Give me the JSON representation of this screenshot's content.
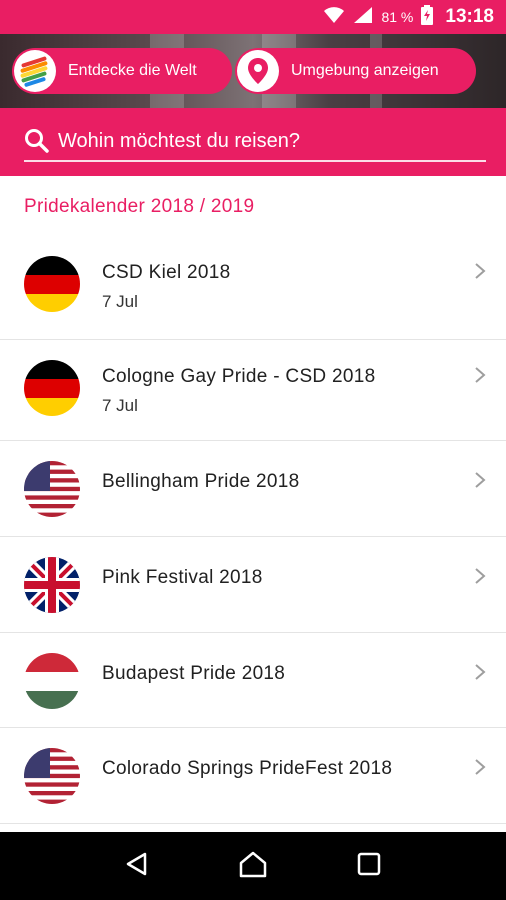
{
  "status_bar": {
    "battery_percent": "81 %",
    "time": "13:18",
    "icons": [
      "wifi-icon",
      "signal-icon",
      "battery-icon"
    ]
  },
  "header": {
    "discover_button_label": "Entdecke die Welt",
    "nearby_button_label": "Umgebung anzeigen"
  },
  "search": {
    "placeholder": "Wohin möchtest du reisen?"
  },
  "section": {
    "title": "Pridekalender 2018 / 2019"
  },
  "events": [
    {
      "name": "CSD Kiel 2018",
      "date": "7 Jul",
      "flag": "germany"
    },
    {
      "name": "Cologne Gay Pride - CSD 2018",
      "date": "7 Jul",
      "flag": "germany"
    },
    {
      "name": "Bellingham Pride 2018",
      "date": "",
      "flag": "usa"
    },
    {
      "name": "Pink Festival 2018",
      "date": "",
      "flag": "uk"
    },
    {
      "name": "Budapest Pride 2018",
      "date": "",
      "flag": "hungary"
    },
    {
      "name": "Colorado Springs PrideFest 2018",
      "date": "",
      "flag": "usa"
    }
  ],
  "colors": {
    "accent": "#e91e63",
    "nav_bar": "#000000"
  }
}
